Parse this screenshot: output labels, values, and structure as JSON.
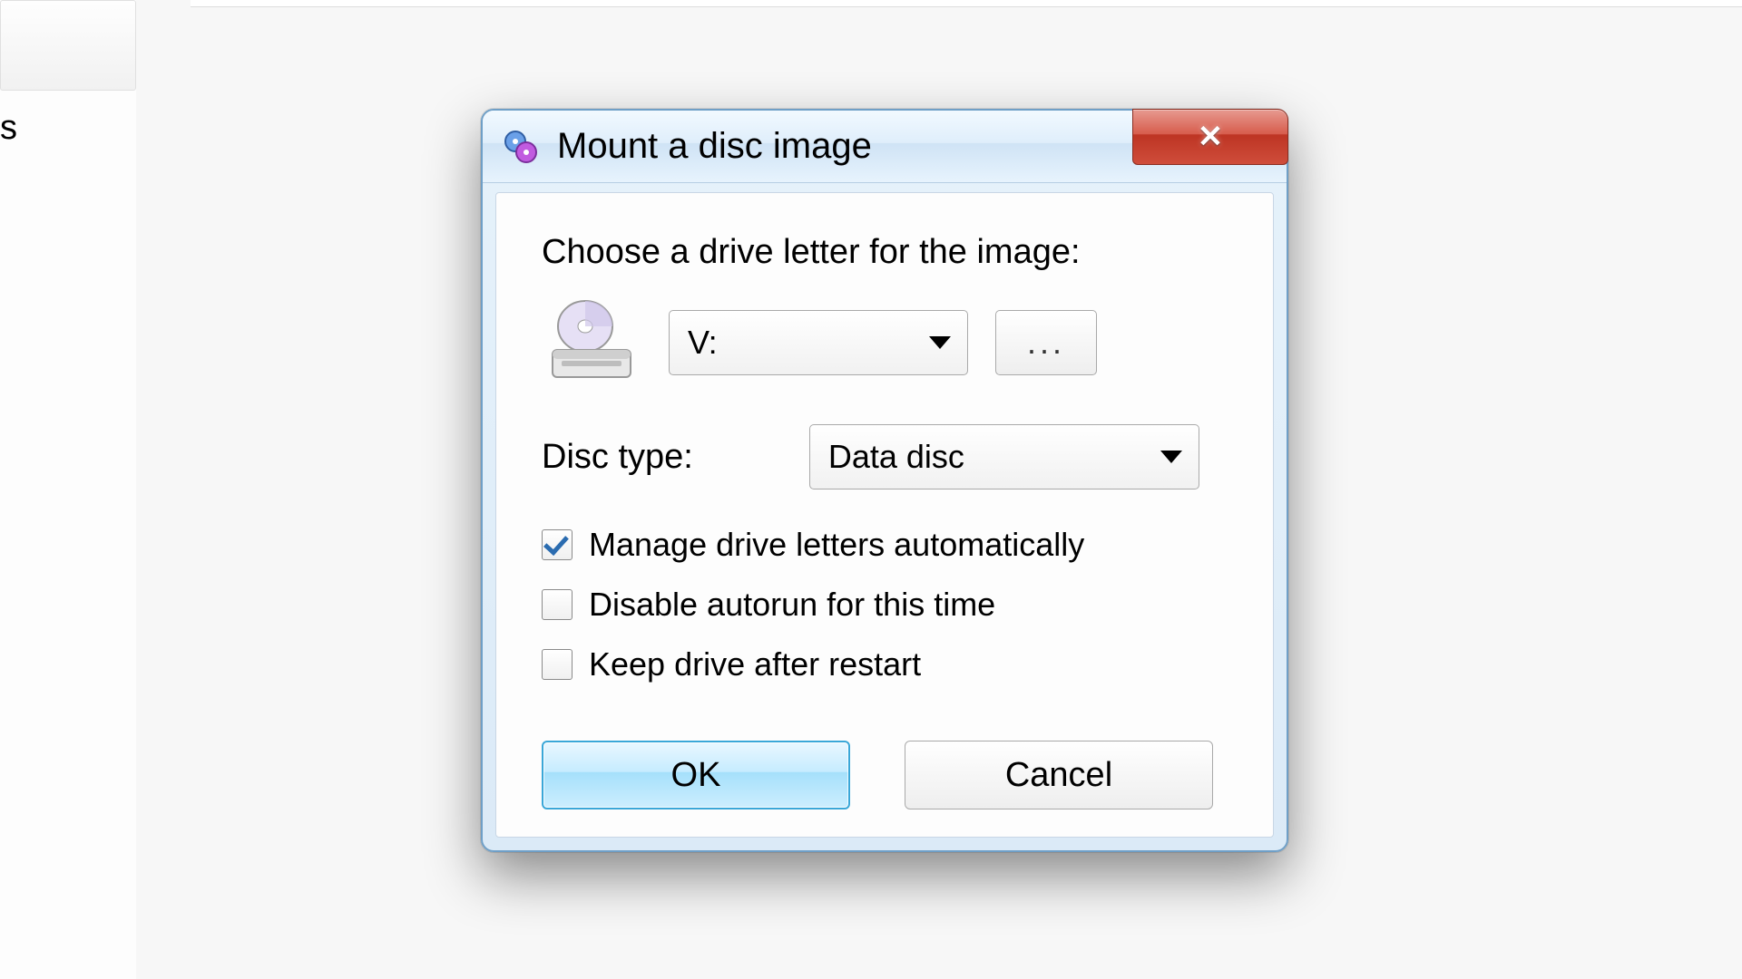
{
  "bg": {
    "left_text_fragment": "s"
  },
  "dialog": {
    "title": "Mount a disc image",
    "close_glyph": "✕",
    "prompt": "Choose a drive letter for the image:",
    "drive_letter_value": "V:",
    "browse_label": "...",
    "disc_type_label": "Disc type:",
    "disc_type_value": "Data disc",
    "checkboxes": {
      "manage": {
        "label": "Manage drive letters automatically",
        "checked": true
      },
      "autorun": {
        "label": "Disable autorun for this time",
        "checked": false
      },
      "keep": {
        "label": "Keep drive after restart",
        "checked": false
      }
    },
    "ok_label": "OK",
    "cancel_label": "Cancel"
  }
}
